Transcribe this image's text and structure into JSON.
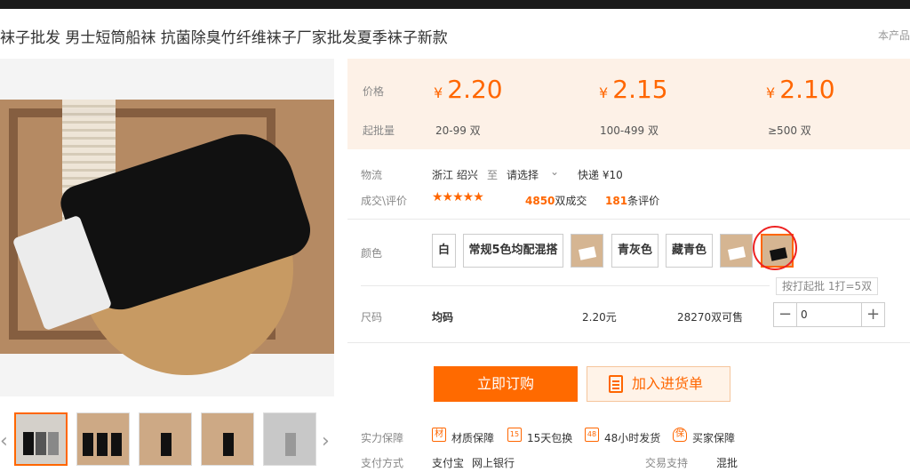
{
  "title": "袜子批发 男士短筒船袜 抗菌除臭竹纤维袜子厂家批发夏季袜子新款",
  "title_right": "本产品",
  "price": {
    "label": "价格",
    "qty_label": "起批量",
    "tiers": [
      {
        "currency": "¥",
        "value": "2.20",
        "qty": "20-99 双"
      },
      {
        "currency": "¥",
        "value": "2.15",
        "qty": "100-499 双"
      },
      {
        "currency": "¥",
        "value": "2.10",
        "qty": "≥500 双"
      }
    ]
  },
  "logistics": {
    "label": "物流",
    "origin": "浙江 绍兴",
    "to": "至",
    "select": "请选择",
    "shipping": "快递 ¥10"
  },
  "trade": {
    "label": "成交\\评价",
    "rating": 4.5,
    "deals_num": "4850",
    "deals_text": "双成交",
    "reviews_num": "181",
    "reviews_text": "条评价"
  },
  "color": {
    "label": "颜色",
    "options": [
      {
        "label": "白",
        "image": false
      },
      {
        "label": "常规5色均配混搭",
        "image": false
      },
      {
        "label": "",
        "image": true
      },
      {
        "label": "青灰色",
        "image": false
      },
      {
        "label": "藏青色",
        "image": false
      },
      {
        "label": "",
        "image": true
      },
      {
        "label": "",
        "image": true,
        "selected": true
      }
    ],
    "tip": "按打起批 1打=5双"
  },
  "size": {
    "label": "尺码",
    "value": "均码",
    "price": "2.20元",
    "stock": "28270双可售",
    "quantity": "0"
  },
  "actions": {
    "buy": "立即订购",
    "cart": "加入进货单"
  },
  "guarantee": {
    "label": "实力保障",
    "items": [
      {
        "icon": "material-icon",
        "glyph": "材",
        "label": "材质保障"
      },
      {
        "icon": "fifteen-day-icon",
        "glyph": "15",
        "label": "15天包换"
      },
      {
        "icon": "forty-eight-hour-icon",
        "glyph": "48",
        "label": "48小时发货"
      },
      {
        "icon": "buyer-guarantee-icon",
        "glyph": "保",
        "label": "买家保障"
      }
    ]
  },
  "payment": {
    "label": "支付方式",
    "alipay": "支付宝",
    "bank": "网上银行",
    "trade_label": "交易支持",
    "trade_value": "混批"
  },
  "colors": {
    "accent": "#ff6a00",
    "price_bg": "#fdf1e7",
    "highlight_circle": "#e22222"
  }
}
